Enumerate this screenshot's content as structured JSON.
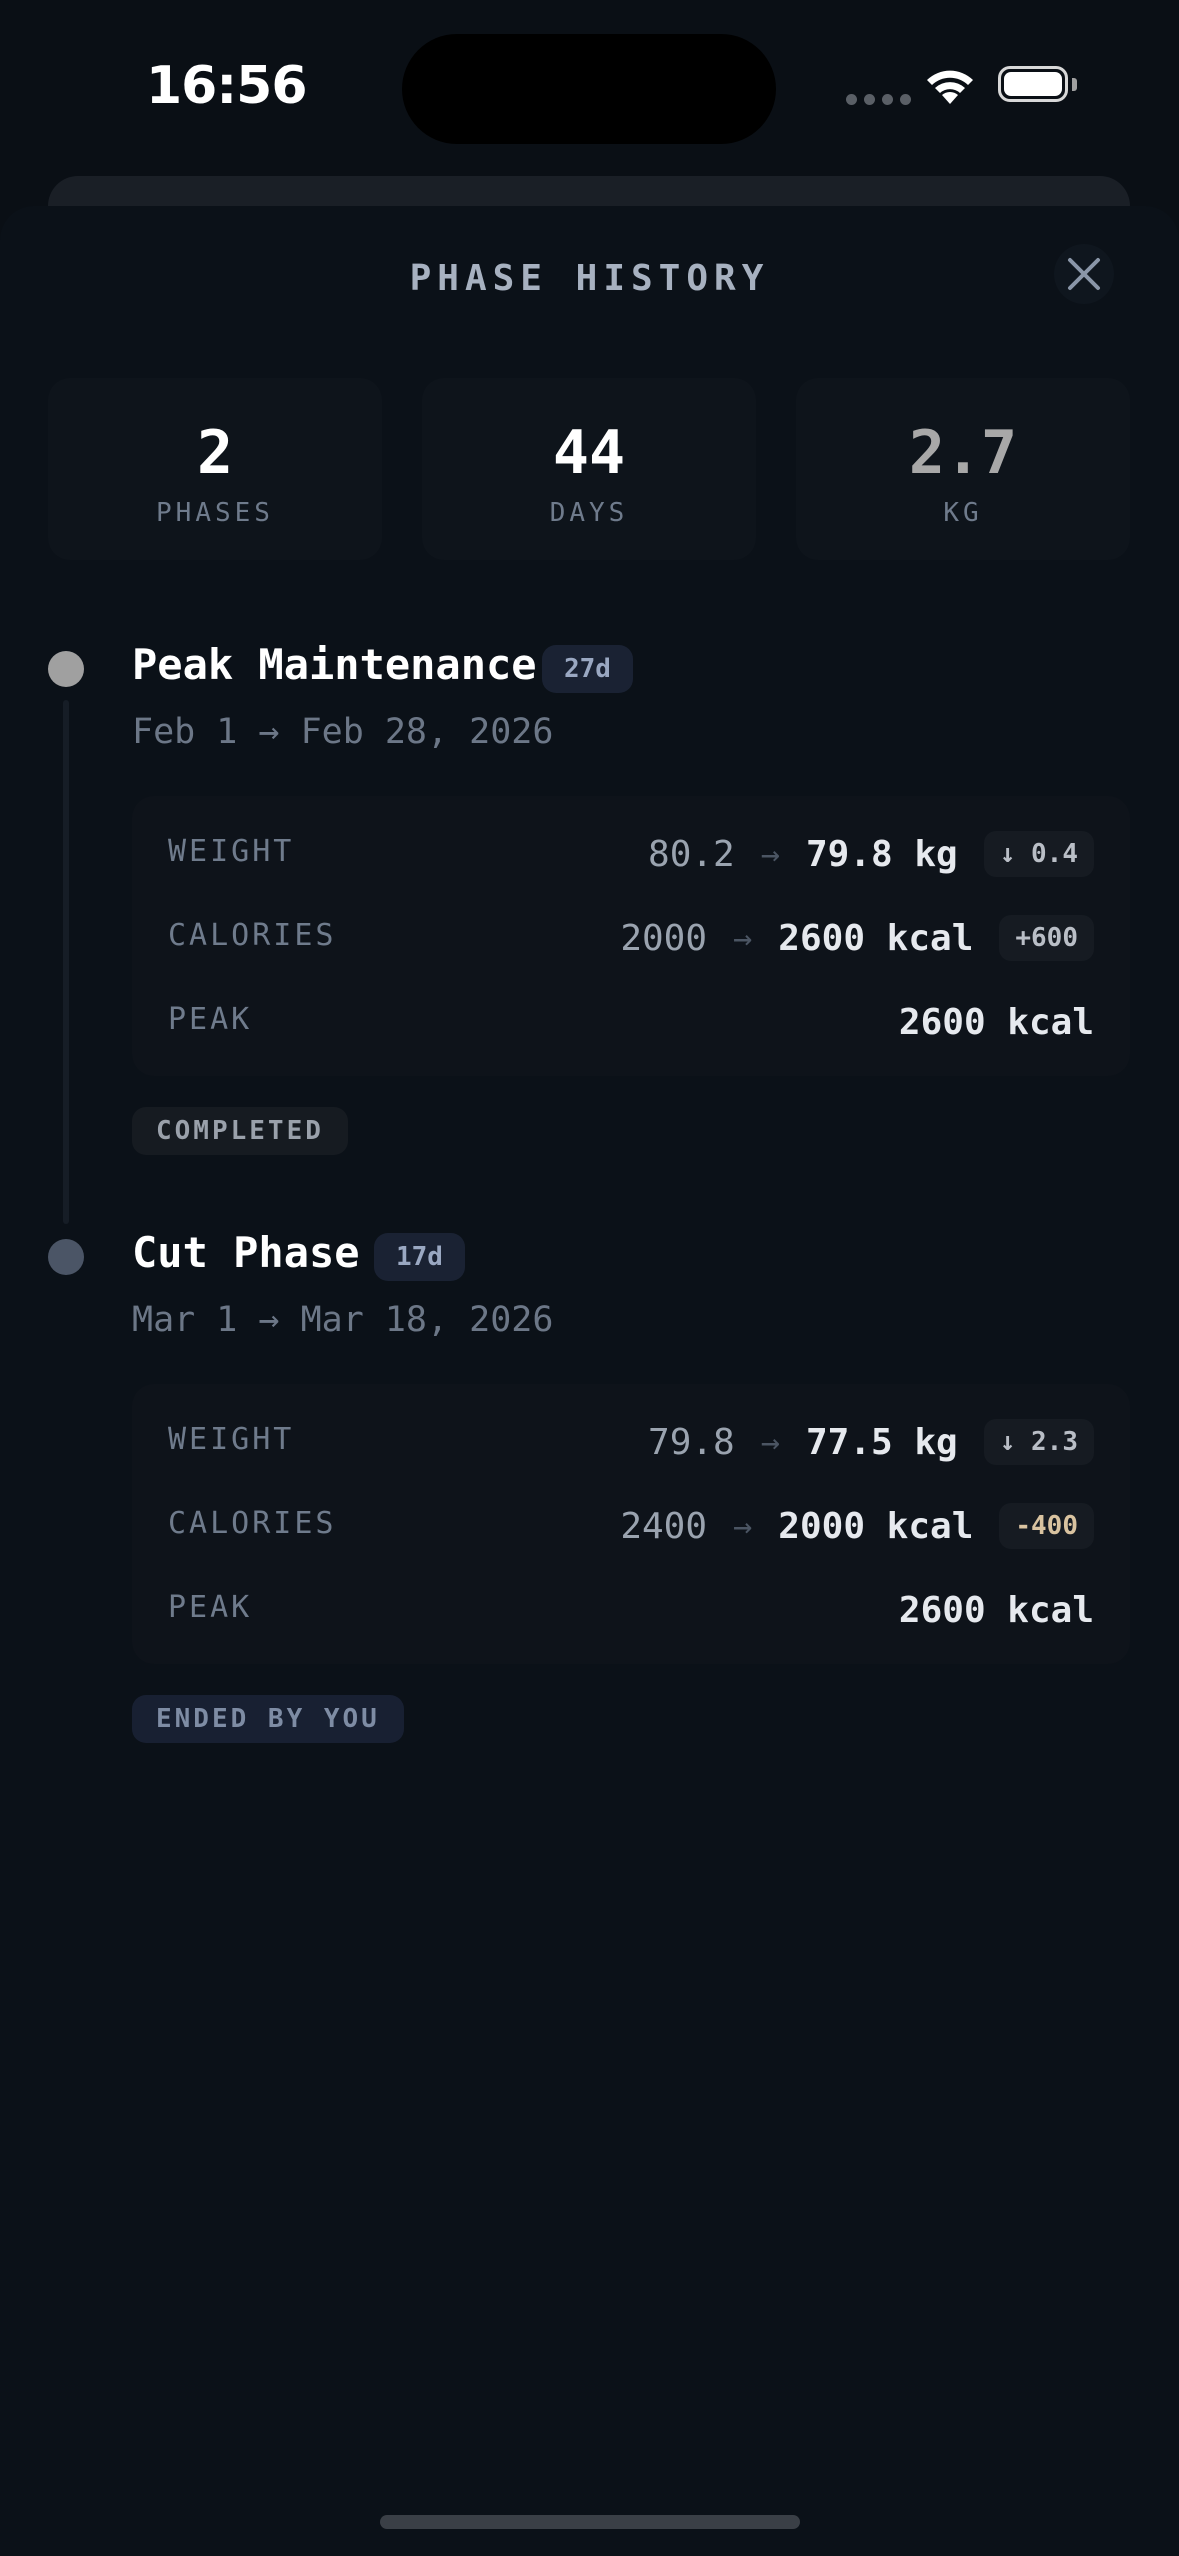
{
  "status_bar": {
    "time": "16:56"
  },
  "sheet": {
    "title": "PHASE HISTORY"
  },
  "stats": [
    {
      "value": "2",
      "label": "PHASES",
      "color": "#ffffff"
    },
    {
      "value": "44",
      "label": "DAYS",
      "color": "#ffffff"
    },
    {
      "value": "2.7",
      "label": "KG",
      "color": "#a8a8a8"
    }
  ],
  "phases": [
    {
      "title": "Peak Maintenance",
      "duration": "27d",
      "dates": "Feb 1 → Feb 28, 2026",
      "dot_color": "#a0a0a0",
      "weight": {
        "label": "WEIGHT",
        "from": "80.2",
        "arrow": "→",
        "to": "79.8 kg",
        "delta": "↓ 0.4"
      },
      "calories": {
        "label": "CALORIES",
        "from": "2000",
        "arrow": "→",
        "to": "2600 kcal",
        "delta": "+600"
      },
      "peak": {
        "label": "PEAK",
        "value": "2600 kcal"
      },
      "status": "COMPLETED"
    },
    {
      "title": "Cut Phase",
      "duration": "17d",
      "dates": "Mar 1 → Mar 18, 2026",
      "dot_color": "#4b5566",
      "weight": {
        "label": "WEIGHT",
        "from": "79.8",
        "arrow": "→",
        "to": "77.5 kg",
        "delta": "↓ 2.3"
      },
      "calories": {
        "label": "CALORIES",
        "from": "2400",
        "arrow": "→",
        "to": "2000 kcal",
        "delta": "-400"
      },
      "peak": {
        "label": "PEAK",
        "value": "2600 kcal"
      },
      "status": "ENDED BY YOU"
    }
  ]
}
